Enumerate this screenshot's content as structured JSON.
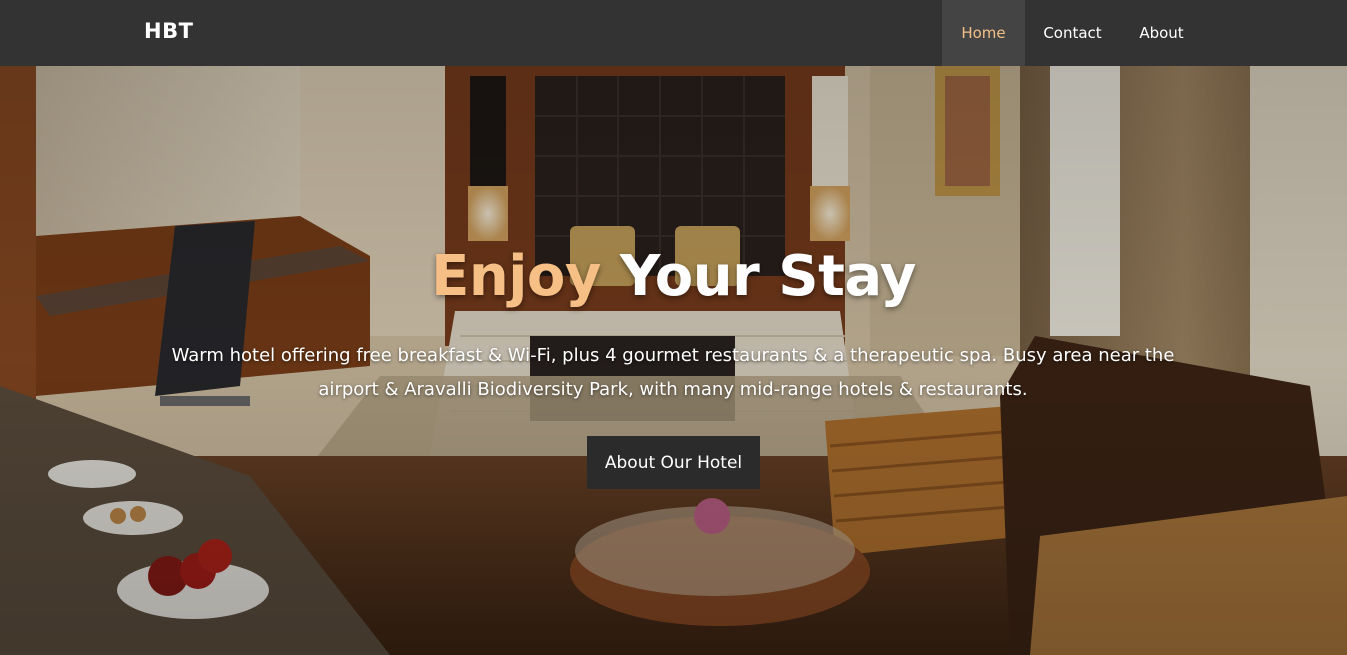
{
  "navbar": {
    "brand": "HBT",
    "links": [
      {
        "label": "Home",
        "active": true
      },
      {
        "label": "Contact",
        "active": false
      },
      {
        "label": "About",
        "active": false
      }
    ]
  },
  "hero": {
    "title_accent": "Enjoy",
    "title_rest": " Your Stay",
    "description": "Warm hotel offering free breakfast & Wi-Fi, plus 4 gourmet restaurants & a therapeutic spa. Busy area near the airport & Aravalli Biodiversity Park, with many mid-range hotels & restaurants.",
    "button_label": "About Our Hotel",
    "background_image": "hotel-room-photo"
  },
  "colors": {
    "navbar_bg": "#333333",
    "active_nav_bg": "#444444",
    "accent": "#f5bf86",
    "button_bg": "#2b2b2b"
  }
}
